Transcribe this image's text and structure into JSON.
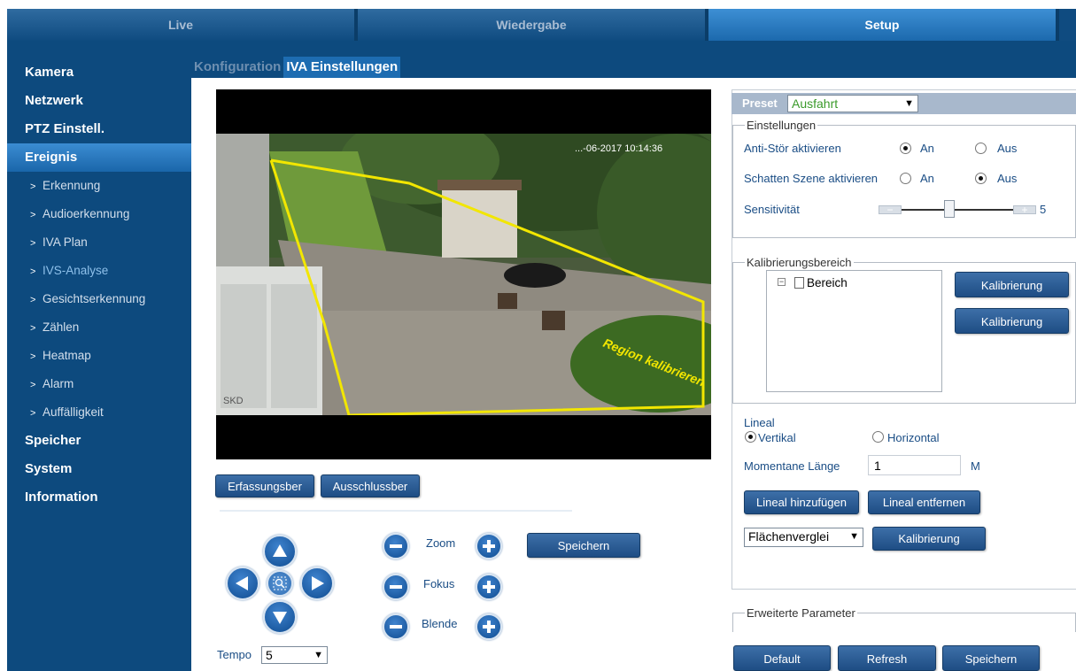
{
  "topnav": {
    "tabs": [
      "Live",
      "Wiedergabe",
      "Setup"
    ]
  },
  "sidebar": {
    "main": [
      "Kamera",
      "Netzwerk",
      "PTZ Einstell.",
      "Ereignis"
    ],
    "sub": [
      "Erkennung",
      "Audioerkennung",
      "IVA Plan",
      "IVS-Analyse",
      "Gesichtserkennung",
      "Zählen",
      "Heatmap",
      "Alarm",
      "Auffälligkeit"
    ],
    "bottom": [
      "Speicher",
      "System",
      "Information"
    ]
  },
  "content_tabs": [
    "Konfiguration",
    "IVA Einstellungen"
  ],
  "video": {
    "overlay_time": "...-06-2017 10:14:36",
    "region_label": "Region kalibrieren",
    "watermark": "SKD"
  },
  "area_buttons": {
    "detection": "Erfassungsber",
    "exclusion": "Ausschlussber"
  },
  "ptz": {
    "zoom": "Zoom",
    "focus": "Fokus",
    "iris": "Blende",
    "save": "Speichern",
    "speed_label": "Tempo",
    "speed_value": "5"
  },
  "preset": {
    "label": "Preset",
    "value": "Ausfahrt"
  },
  "settings": {
    "legend": "Einstellungen",
    "anti_interference": "Anti-Stör aktivieren",
    "shadow": "Schatten Szene aktivieren",
    "on": "An",
    "off": "Aus",
    "sensitivity": "Sensitivität",
    "sensitivity_value": "5",
    "slider_minus": "−",
    "slider_plus": "+"
  },
  "calibration": {
    "legend": "Kalibrierungsbereich",
    "tree_item": "Bereich",
    "btn1": "Kalibrierung",
    "btn2": "Kalibrierung"
  },
  "ruler": {
    "label": "Lineal",
    "vertical": "Vertikal",
    "horizontal": "Horizontal",
    "length_label": "Momentane Länge",
    "length_value": "1",
    "unit": "M",
    "add": "Lineal hinzufügen",
    "remove": "Lineal entfernen",
    "compare_value": "Flächenverglei",
    "calibrate": "Kalibrierung"
  },
  "advanced": {
    "legend": "Erweiterte Parameter"
  },
  "footer_buttons": {
    "default": "Default",
    "refresh": "Refresh",
    "save": "Speichern"
  }
}
